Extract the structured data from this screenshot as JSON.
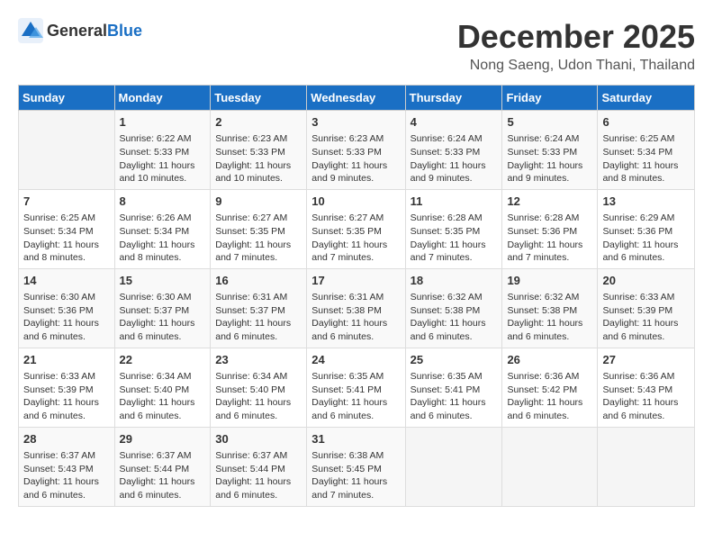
{
  "header": {
    "logo_general": "General",
    "logo_blue": "Blue",
    "month_title": "December 2025",
    "location": "Nong Saeng, Udon Thani, Thailand"
  },
  "days_of_week": [
    "Sunday",
    "Monday",
    "Tuesday",
    "Wednesday",
    "Thursday",
    "Friday",
    "Saturday"
  ],
  "weeks": [
    [
      {
        "day": "",
        "info": ""
      },
      {
        "day": "1",
        "info": "Sunrise: 6:22 AM\nSunset: 5:33 PM\nDaylight: 11 hours\nand 10 minutes."
      },
      {
        "day": "2",
        "info": "Sunrise: 6:23 AM\nSunset: 5:33 PM\nDaylight: 11 hours\nand 10 minutes."
      },
      {
        "day": "3",
        "info": "Sunrise: 6:23 AM\nSunset: 5:33 PM\nDaylight: 11 hours\nand 9 minutes."
      },
      {
        "day": "4",
        "info": "Sunrise: 6:24 AM\nSunset: 5:33 PM\nDaylight: 11 hours\nand 9 minutes."
      },
      {
        "day": "5",
        "info": "Sunrise: 6:24 AM\nSunset: 5:33 PM\nDaylight: 11 hours\nand 9 minutes."
      },
      {
        "day": "6",
        "info": "Sunrise: 6:25 AM\nSunset: 5:34 PM\nDaylight: 11 hours\nand 8 minutes."
      }
    ],
    [
      {
        "day": "7",
        "info": "Sunrise: 6:25 AM\nSunset: 5:34 PM\nDaylight: 11 hours\nand 8 minutes."
      },
      {
        "day": "8",
        "info": "Sunrise: 6:26 AM\nSunset: 5:34 PM\nDaylight: 11 hours\nand 8 minutes."
      },
      {
        "day": "9",
        "info": "Sunrise: 6:27 AM\nSunset: 5:35 PM\nDaylight: 11 hours\nand 7 minutes."
      },
      {
        "day": "10",
        "info": "Sunrise: 6:27 AM\nSunset: 5:35 PM\nDaylight: 11 hours\nand 7 minutes."
      },
      {
        "day": "11",
        "info": "Sunrise: 6:28 AM\nSunset: 5:35 PM\nDaylight: 11 hours\nand 7 minutes."
      },
      {
        "day": "12",
        "info": "Sunrise: 6:28 AM\nSunset: 5:36 PM\nDaylight: 11 hours\nand 7 minutes."
      },
      {
        "day": "13",
        "info": "Sunrise: 6:29 AM\nSunset: 5:36 PM\nDaylight: 11 hours\nand 6 minutes."
      }
    ],
    [
      {
        "day": "14",
        "info": "Sunrise: 6:30 AM\nSunset: 5:36 PM\nDaylight: 11 hours\nand 6 minutes."
      },
      {
        "day": "15",
        "info": "Sunrise: 6:30 AM\nSunset: 5:37 PM\nDaylight: 11 hours\nand 6 minutes."
      },
      {
        "day": "16",
        "info": "Sunrise: 6:31 AM\nSunset: 5:37 PM\nDaylight: 11 hours\nand 6 minutes."
      },
      {
        "day": "17",
        "info": "Sunrise: 6:31 AM\nSunset: 5:38 PM\nDaylight: 11 hours\nand 6 minutes."
      },
      {
        "day": "18",
        "info": "Sunrise: 6:32 AM\nSunset: 5:38 PM\nDaylight: 11 hours\nand 6 minutes."
      },
      {
        "day": "19",
        "info": "Sunrise: 6:32 AM\nSunset: 5:38 PM\nDaylight: 11 hours\nand 6 minutes."
      },
      {
        "day": "20",
        "info": "Sunrise: 6:33 AM\nSunset: 5:39 PM\nDaylight: 11 hours\nand 6 minutes."
      }
    ],
    [
      {
        "day": "21",
        "info": "Sunrise: 6:33 AM\nSunset: 5:39 PM\nDaylight: 11 hours\nand 6 minutes."
      },
      {
        "day": "22",
        "info": "Sunrise: 6:34 AM\nSunset: 5:40 PM\nDaylight: 11 hours\nand 6 minutes."
      },
      {
        "day": "23",
        "info": "Sunrise: 6:34 AM\nSunset: 5:40 PM\nDaylight: 11 hours\nand 6 minutes."
      },
      {
        "day": "24",
        "info": "Sunrise: 6:35 AM\nSunset: 5:41 PM\nDaylight: 11 hours\nand 6 minutes."
      },
      {
        "day": "25",
        "info": "Sunrise: 6:35 AM\nSunset: 5:41 PM\nDaylight: 11 hours\nand 6 minutes."
      },
      {
        "day": "26",
        "info": "Sunrise: 6:36 AM\nSunset: 5:42 PM\nDaylight: 11 hours\nand 6 minutes."
      },
      {
        "day": "27",
        "info": "Sunrise: 6:36 AM\nSunset: 5:43 PM\nDaylight: 11 hours\nand 6 minutes."
      }
    ],
    [
      {
        "day": "28",
        "info": "Sunrise: 6:37 AM\nSunset: 5:43 PM\nDaylight: 11 hours\nand 6 minutes."
      },
      {
        "day": "29",
        "info": "Sunrise: 6:37 AM\nSunset: 5:44 PM\nDaylight: 11 hours\nand 6 minutes."
      },
      {
        "day": "30",
        "info": "Sunrise: 6:37 AM\nSunset: 5:44 PM\nDaylight: 11 hours\nand 6 minutes."
      },
      {
        "day": "31",
        "info": "Sunrise: 6:38 AM\nSunset: 5:45 PM\nDaylight: 11 hours\nand 7 minutes."
      },
      {
        "day": "",
        "info": ""
      },
      {
        "day": "",
        "info": ""
      },
      {
        "day": "",
        "info": ""
      }
    ]
  ]
}
